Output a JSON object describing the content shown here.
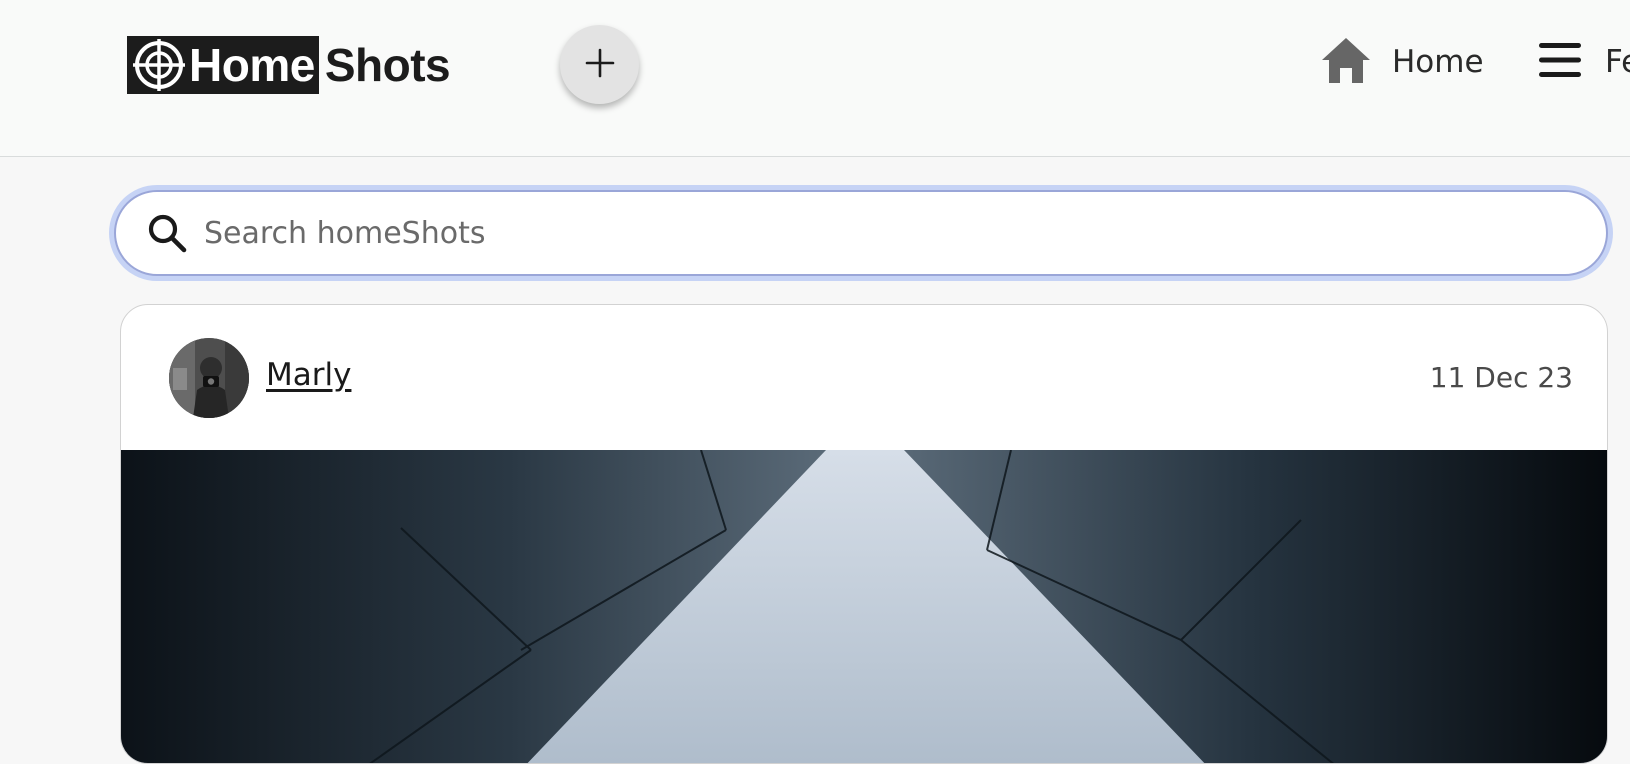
{
  "header": {
    "logo": {
      "part1": "Home",
      "part2": "Shots",
      "icon": "crosshair-icon"
    },
    "add_button": {
      "icon": "plus-icon"
    },
    "nav": {
      "home": {
        "label": "Home",
        "icon": "home-icon"
      },
      "feed": {
        "label": "Fe",
        "icon": "menu-icon"
      }
    }
  },
  "search": {
    "placeholder": "Search homeShots",
    "value": "",
    "icon": "search-icon"
  },
  "post": {
    "author": "Marly",
    "date": "11 Dec 23",
    "avatar_icon": "avatar-photo",
    "image": "building-skyward-photo"
  },
  "colors": {
    "header_bg": "#f9faf9",
    "page_bg": "#f7f7f7",
    "focus_ring": "#c6d3f5",
    "logo_dark": "#1c1c1c",
    "icon_gray": "#666666"
  }
}
